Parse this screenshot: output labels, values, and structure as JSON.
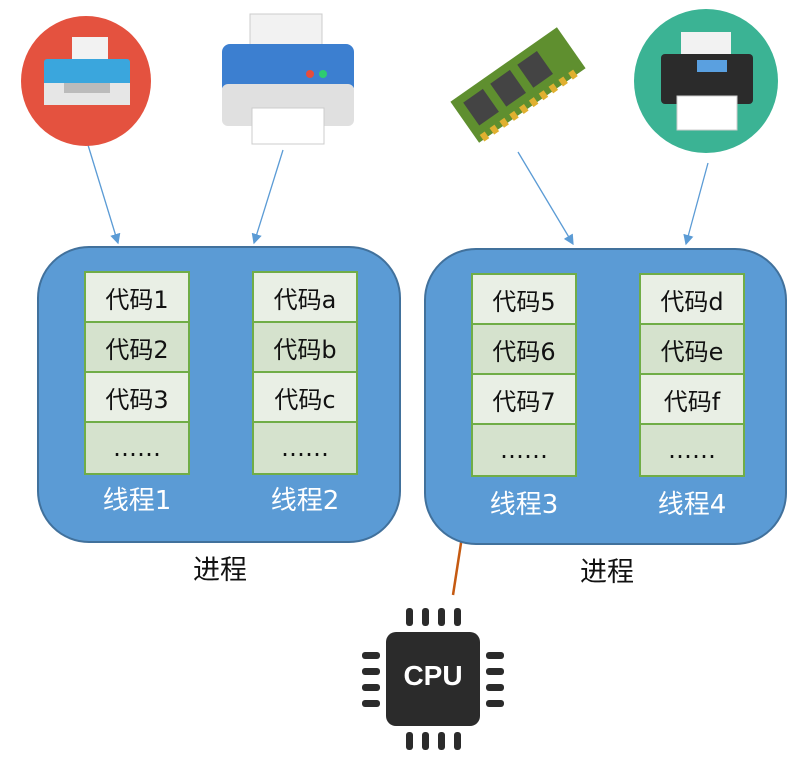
{
  "processes": [
    {
      "label": "进程",
      "threads": [
        {
          "label": "线程1",
          "codes": [
            "代码1",
            "代码2",
            "代码3",
            "……"
          ]
        },
        {
          "label": "线程2",
          "codes": [
            "代码a",
            "代码b",
            "代码c",
            "……"
          ]
        }
      ]
    },
    {
      "label": "进程",
      "threads": [
        {
          "label": "线程3",
          "codes": [
            "代码5",
            "代码6",
            "代码7",
            "……"
          ]
        },
        {
          "label": "线程4",
          "codes": [
            "代码d",
            "代码e",
            "代码f",
            "……"
          ]
        }
      ]
    }
  ],
  "cpu": {
    "label": "CPU"
  },
  "devices": [
    "printer-icon",
    "printer-icon",
    "memory-icon",
    "printer-icon"
  ],
  "colors": {
    "process": "#5b9bd5",
    "thread_border": "#70ad47",
    "arrow": "#5b9bd5",
    "cpu_arrow": "#c55a11"
  }
}
